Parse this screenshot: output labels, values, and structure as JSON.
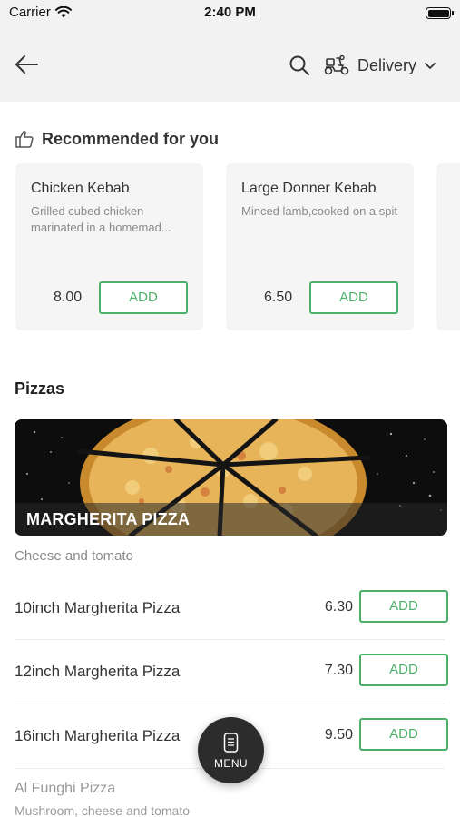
{
  "status_bar": {
    "carrier": "Carrier",
    "time": "2:40 PM"
  },
  "header": {
    "delivery_label": "Delivery"
  },
  "recommended": {
    "title": "Recommended for you",
    "items": [
      {
        "name": "Chicken Kebab",
        "description": "Grilled cubed chicken marinated in a homemad...",
        "price": "8.00",
        "add_label": "ADD"
      },
      {
        "name": "Large Donner Kebab",
        "description": "Minced lamb,cooked on a spit",
        "price": "6.50",
        "add_label": "ADD"
      }
    ]
  },
  "section": {
    "title": "Pizzas",
    "banner_label": "MARGHERITA PIZZA",
    "description": "Cheese and tomato",
    "items": [
      {
        "name": "10inch Margherita Pizza",
        "price": "6.30",
        "add_label": "ADD"
      },
      {
        "name": "12inch Margherita Pizza",
        "price": "7.30",
        "add_label": "ADD"
      },
      {
        "name": "16inch Margherita Pizza",
        "price": "9.50",
        "add_label": "ADD"
      }
    ],
    "next_item": {
      "name": "Al Funghi Pizza",
      "description": "Mushroom, cheese and tomato"
    }
  },
  "menu_button": {
    "label": "MENU"
  },
  "colors": {
    "accent": "#4caf6a",
    "header_bg": "#f2f2f2",
    "card_bg": "#f5f5f5",
    "fab_bg": "#2c2c2c"
  },
  "icons": [
    "back-arrow-icon",
    "search-icon",
    "delivery-scooter-icon",
    "chevron-down-icon",
    "thumbs-up-icon",
    "menu-phone-icon",
    "wifi-icon",
    "battery-icon"
  ]
}
